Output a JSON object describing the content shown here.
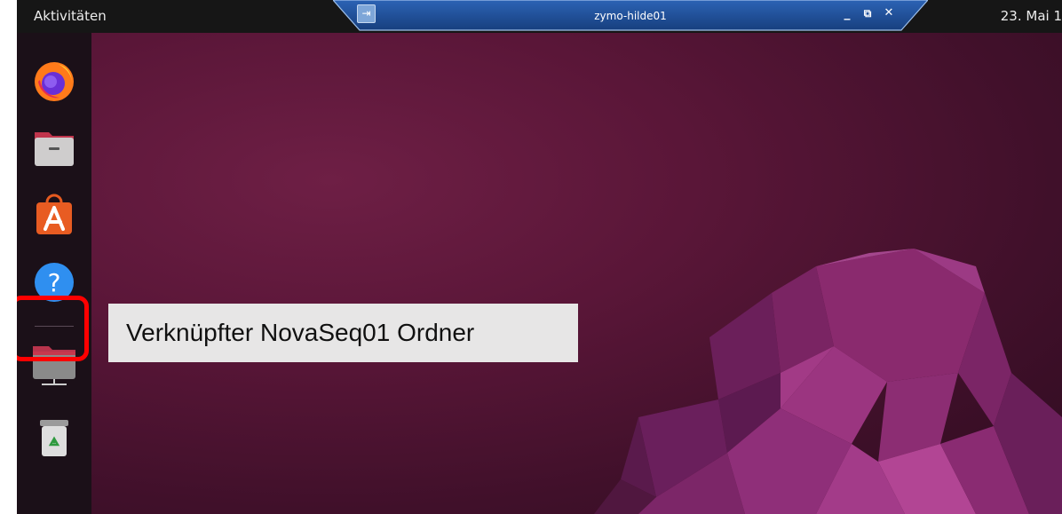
{
  "topbar": {
    "activities_label": "Aktivitäten",
    "clock_text": "23. Mai 1"
  },
  "remote_bar": {
    "title": "zymo-hilde01",
    "pin_glyph": "⇥",
    "minimize_glyph": "_",
    "restore_glyph": "⧉",
    "close_glyph": "✕"
  },
  "dock": {
    "items": [
      {
        "name": "Firefox",
        "icon": "firefox-icon"
      },
      {
        "name": "Dateien",
        "icon": "files-icon"
      },
      {
        "name": "Ubuntu Software",
        "icon": "software-icon"
      },
      {
        "name": "Hilfe",
        "icon": "help-icon"
      },
      {
        "name": "NovaSeq01",
        "icon": "network-folder-icon"
      },
      {
        "name": "Papierkorb",
        "icon": "trash-icon"
      }
    ]
  },
  "annotation": {
    "callout_text": "Verknüpfter NovaSeq01 Ordner"
  },
  "colors": {
    "highlight": "#ff0000",
    "callout_bg": "#e7e6e6",
    "wallpaper": "#5a1638",
    "remote_bar": "#1f4e94"
  }
}
